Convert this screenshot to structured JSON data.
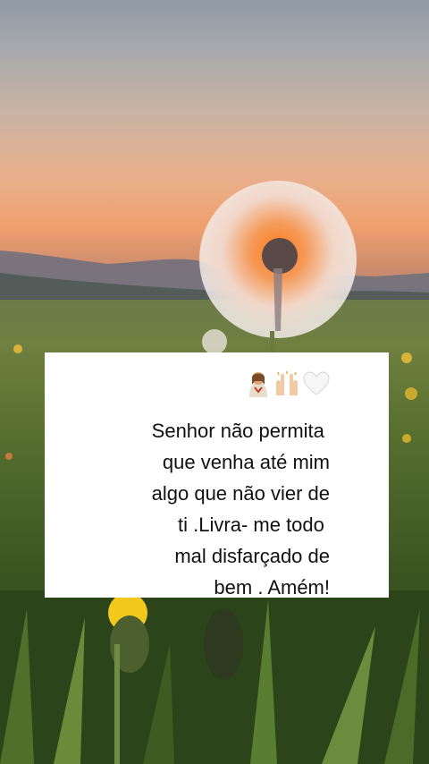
{
  "quote": {
    "emoji_icons": [
      "jesus-emoji-icon",
      "praising-hands-emoji-icon",
      "white-heart-emoji-icon"
    ],
    "lines": [
      "Senhor não permita ",
      "que venha até mim",
      "algo que não vier de",
      "ti .Livra- me todo ",
      "mal disfarçado de",
      "bem . Amém!"
    ]
  },
  "colors": {
    "card_background": "#ffffff",
    "text": "#111111"
  }
}
